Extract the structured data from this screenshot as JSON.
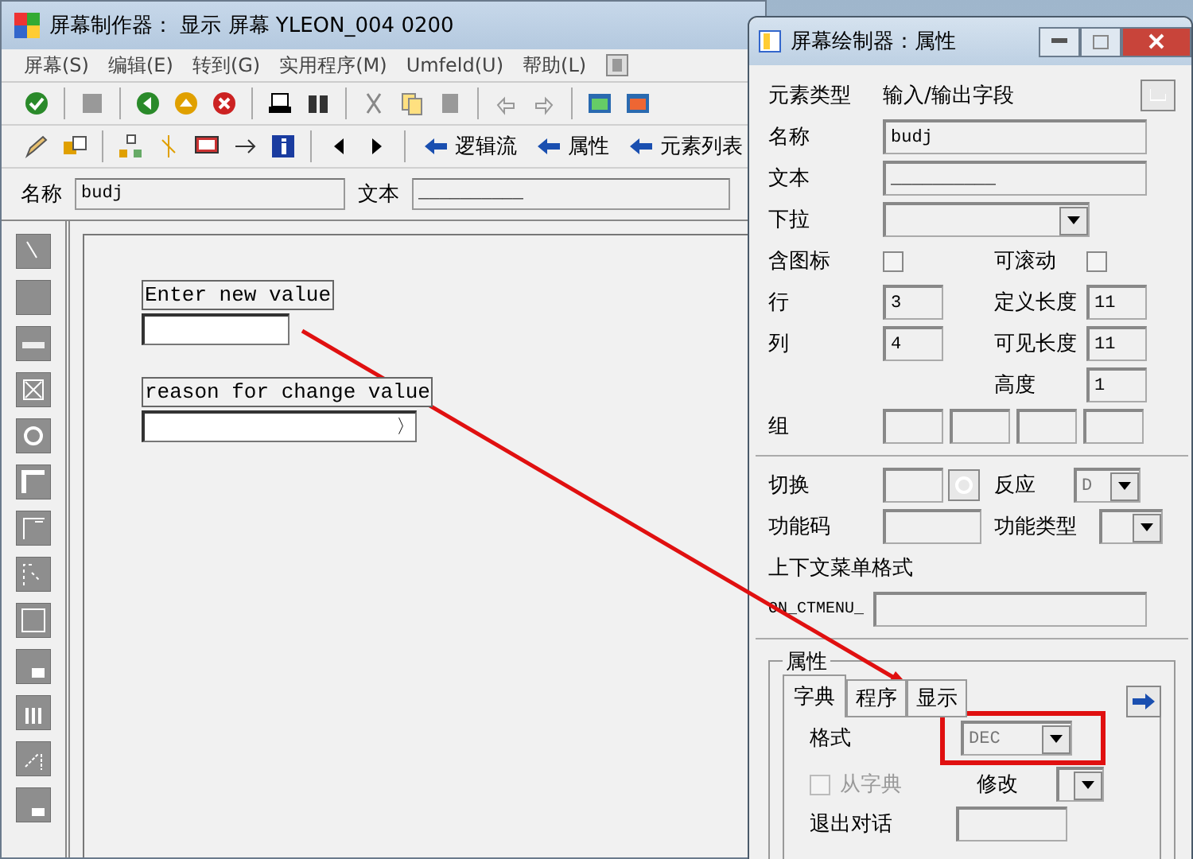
{
  "main_window": {
    "title": "屏幕制作器： 显示 屏幕 YLEON_004 0200",
    "menu": [
      "屏幕(S)",
      "编辑(E)",
      "转到(G)",
      "实用程序(M)",
      "Umfeld(U)",
      "帮助(L)"
    ],
    "nav_buttons": [
      "逻辑流",
      "属性",
      "元素列表"
    ],
    "name_label": "名称",
    "name_value": "budj",
    "text_label": "文本",
    "text_value": "__________",
    "canvas_elements": [
      {
        "kind": "label",
        "text": "Enter new value"
      },
      {
        "kind": "input"
      },
      {
        "kind": "label",
        "text": "reason for change value"
      },
      {
        "kind": "scroll_input",
        "end_mark": "〉"
      }
    ]
  },
  "dialog": {
    "title": "屏幕绘制器：属性",
    "element_type_label": "元素类型",
    "element_type": "输入/输出字段",
    "name_label": "名称",
    "name_value": "budj",
    "text_label": "文本",
    "text_value": "__________",
    "dropdown_label": "下拉",
    "with_icon": {
      "label": "含图标",
      "checked": false
    },
    "scrollable": {
      "label": "可滚动",
      "checked": false
    },
    "row_label": "行",
    "row_value": "3",
    "def_length_label": "定义长度",
    "def_length_value": "11",
    "col_label": "列",
    "col_value": "4",
    "vis_length_label": "可见长度",
    "vis_length_value": "11",
    "height_label": "高度",
    "height_value": "1",
    "group_label": "组",
    "switch_label": "切换",
    "response_label": "反应",
    "response_value": "D",
    "fcode_label": "功能码",
    "ftype_label": "功能类型",
    "context_label": "上下文菜单格式",
    "context_prefix": "ON_CTMENU_",
    "attributes_title": "属性",
    "tabs": [
      {
        "label": "字典",
        "selected": true
      },
      {
        "label": "程序",
        "selected": false
      },
      {
        "label": "显示",
        "selected": false
      }
    ],
    "format_label": "格式",
    "format_value": "DEC",
    "from_dict": {
      "label": "从字典",
      "checked": false,
      "disabled": true
    },
    "modify_label": "修改",
    "exit_label": "退出对话"
  }
}
